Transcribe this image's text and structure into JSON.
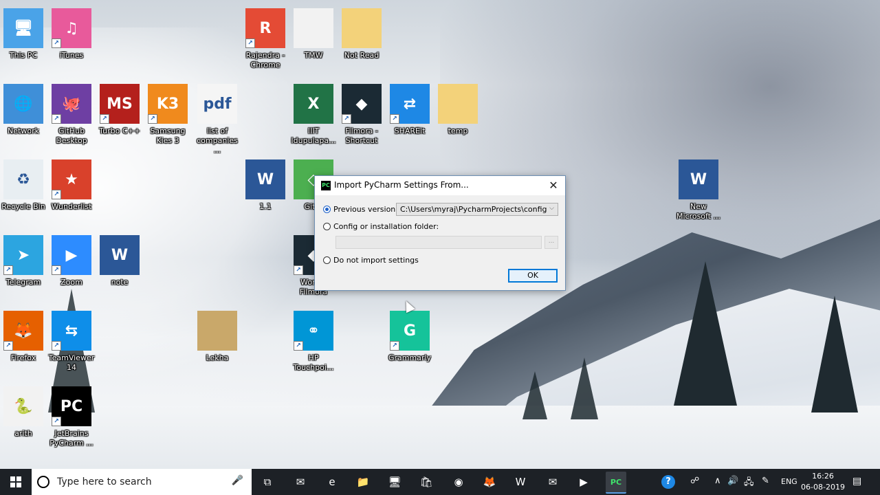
{
  "desktop": {
    "icons": [
      {
        "label": "This PC",
        "glyph": "🖥",
        "bg": "#4aa3e8",
        "shortcut": false
      },
      {
        "label": "iTunes",
        "glyph": "♫",
        "bg": "#e85a9b",
        "shortcut": true
      },
      {
        "label": "Rajendra -\nChrome",
        "glyph": "R",
        "bg": "#e44b35",
        "shortcut": true
      },
      {
        "label": "TMW",
        "glyph": "",
        "bg": "#f2f2f2",
        "shortcut": false
      },
      {
        "label": "Not Read",
        "glyph": "",
        "bg": "#f3d27a",
        "shortcut": false
      },
      {
        "label": "Network",
        "glyph": "🌐",
        "bg": "#3f8fd8",
        "shortcut": false
      },
      {
        "label": "GitHub\nDesktop",
        "glyph": "🐙",
        "bg": "#6e3fa3",
        "shortcut": true
      },
      {
        "label": "Turbo C++",
        "glyph": "MS",
        "bg": "#b4201c",
        "shortcut": true
      },
      {
        "label": "Samsung\nKies 3",
        "glyph": "K3",
        "bg": "#f08a1d",
        "shortcut": true
      },
      {
        "label": "list of\ncompanies ...",
        "glyph": "pdf",
        "bg": "#f5f5f5",
        "shortcut": false
      },
      {
        "label": "IIIT\nIdupulapa...",
        "glyph": "X",
        "bg": "#217346",
        "shortcut": false
      },
      {
        "label": "Filmora -\nShortcut",
        "glyph": "◆",
        "bg": "#1b2a34",
        "shortcut": true
      },
      {
        "label": "SHAREit",
        "glyph": "⇄",
        "bg": "#1e88e5",
        "shortcut": true
      },
      {
        "label": "temp",
        "glyph": "",
        "bg": "#f3d27a",
        "shortcut": false
      },
      {
        "label": "Recycle Bin",
        "glyph": "♻",
        "bg": "#e8eef2",
        "shortcut": false
      },
      {
        "label": "Wunderlist",
        "glyph": "★",
        "bg": "#d9412b",
        "shortcut": true
      },
      {
        "label": "1.1",
        "glyph": "W",
        "bg": "#2b5797",
        "shortcut": false
      },
      {
        "label": "Git B",
        "glyph": "◇",
        "bg": "#4caf50",
        "shortcut": false
      },
      {
        "label": "New\nMicrosoft ...",
        "glyph": "W",
        "bg": "#2b5797",
        "shortcut": false
      },
      {
        "label": "Telegram",
        "glyph": "➤",
        "bg": "#2ca5e0",
        "shortcut": true
      },
      {
        "label": "Zoom",
        "glyph": "▶",
        "bg": "#2d8cff",
        "shortcut": true
      },
      {
        "label": "note",
        "glyph": "W",
        "bg": "#2b5797",
        "shortcut": false
      },
      {
        "label": "Wonde\nFilmora",
        "glyph": "◆",
        "bg": "#1b2a34",
        "shortcut": true
      },
      {
        "label": "Firefox",
        "glyph": "🦊",
        "bg": "#e66000",
        "shortcut": true
      },
      {
        "label": "TeamViewer\n14",
        "glyph": "⇆",
        "bg": "#0e8ee9",
        "shortcut": true
      },
      {
        "label": "Lekha",
        "glyph": "",
        "bg": "#c9a86a",
        "shortcut": false
      },
      {
        "label": "HP\nTouchpoi...",
        "glyph": "⚭",
        "bg": "#0096d6",
        "shortcut": true
      },
      {
        "label": "Grammarly",
        "glyph": "G",
        "bg": "#15c39a",
        "shortcut": true
      },
      {
        "label": "arith",
        "glyph": "🐍",
        "bg": "#f2f2f2",
        "shortcut": false
      },
      {
        "label": "JetBrains\nPyCharm ...",
        "glyph": "PC",
        "bg": "#000000",
        "shortcut": true
      }
    ]
  },
  "dialog": {
    "title": "Import PyCharm Settings From...",
    "close_glyph": "✕",
    "app_icon_text": "PC",
    "option_previous": "Previous version",
    "previous_path": "C:\\Users\\myraj\\PycharmProjects\\config",
    "option_folder": "Config or installation folder:",
    "folder_path": "",
    "browse_label": "...",
    "option_none": "Do not import settings",
    "ok_label": "OK"
  },
  "taskbar": {
    "search_placeholder": "Type here to search",
    "apps": [
      {
        "name": "task-view-icon",
        "glyph": "⧉",
        "active": false
      },
      {
        "name": "mail-icon",
        "glyph": "✉",
        "active": false
      },
      {
        "name": "edge-icon",
        "glyph": "e",
        "active": false
      },
      {
        "name": "file-explorer-icon",
        "glyph": "📁",
        "active": false
      },
      {
        "name": "pc-settings-icon",
        "glyph": "🖥",
        "active": false
      },
      {
        "name": "store-icon",
        "glyph": "🛍",
        "active": false
      },
      {
        "name": "chrome-icon",
        "glyph": "◉",
        "active": false
      },
      {
        "name": "firefox-icon",
        "glyph": "🦊",
        "active": false
      },
      {
        "name": "word-icon",
        "glyph": "W",
        "active": false
      },
      {
        "name": "outlook-icon",
        "glyph": "✉",
        "active": false
      },
      {
        "name": "zoom-icon",
        "glyph": "▶",
        "active": false
      },
      {
        "name": "pycharm-icon",
        "glyph": "PC",
        "active": true
      }
    ],
    "tray": {
      "help_glyph": "?",
      "people_glyph": "☍",
      "chevron_glyph": "∧",
      "volume_glyph": "🔊",
      "network_glyph": "🖧",
      "pen_glyph": "✎",
      "language": "ENG",
      "time": "16:26",
      "date": "06-08-2019",
      "notification_glyph": "▤"
    }
  }
}
